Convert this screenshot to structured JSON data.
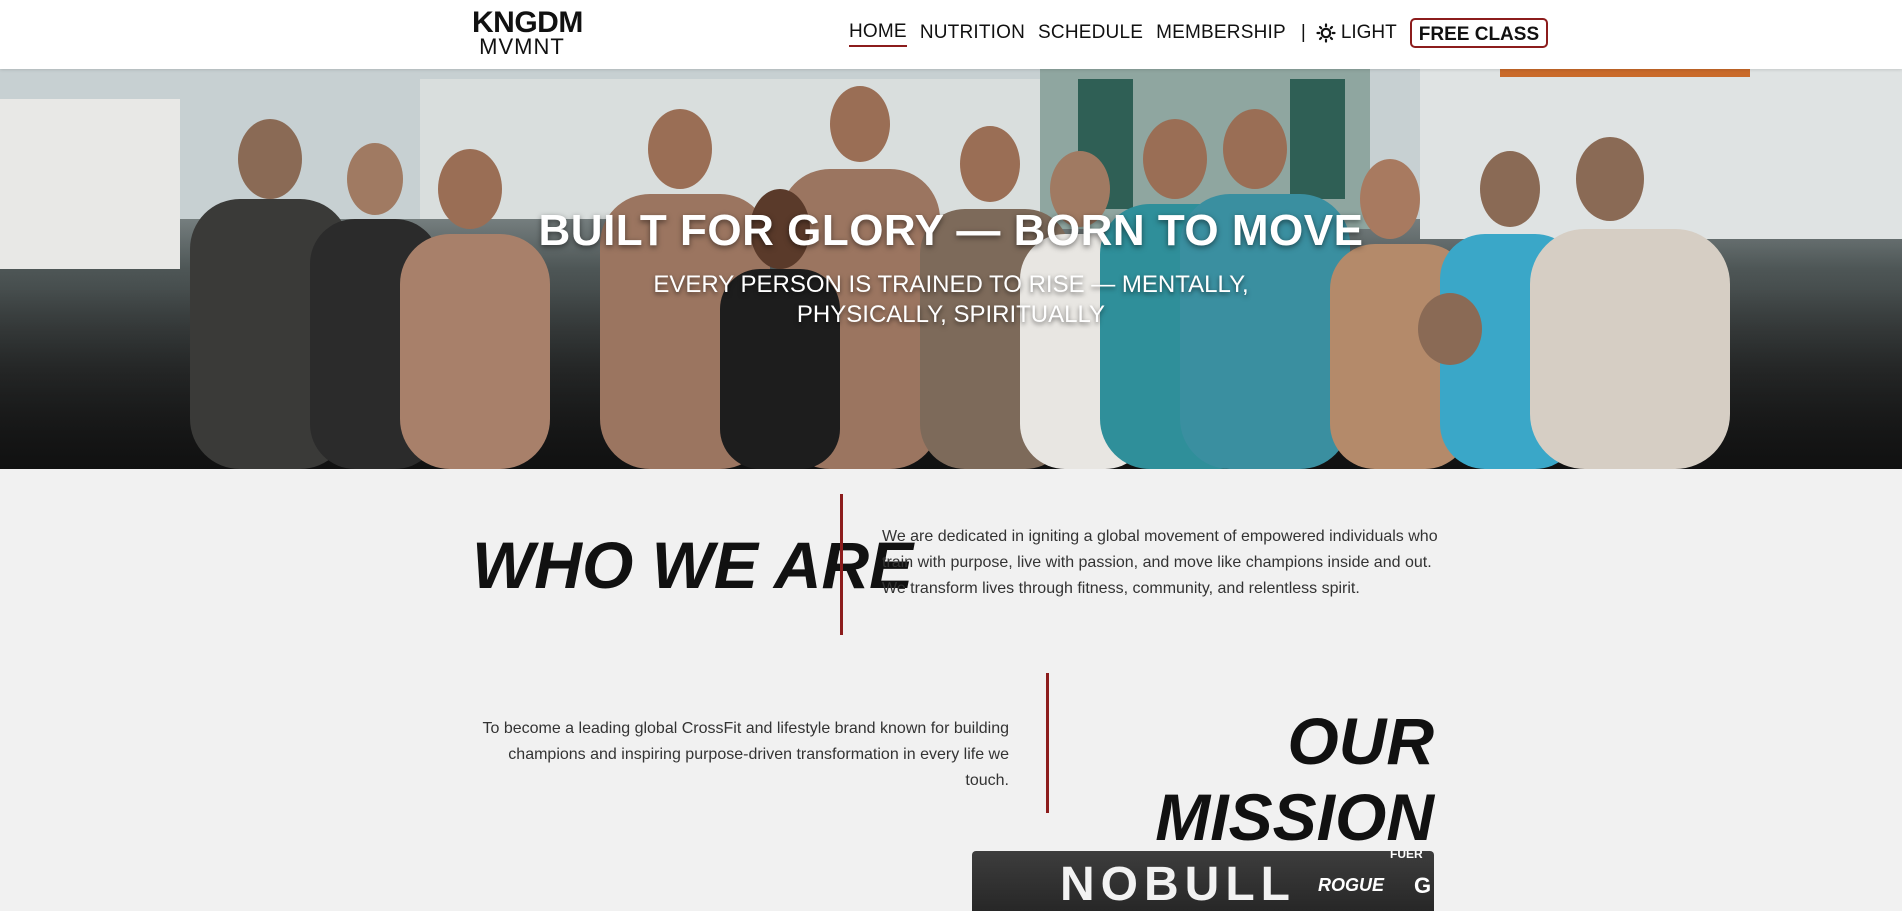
{
  "header": {
    "logo_top": "KNGDM",
    "logo_bottom": "MVMNT",
    "nav": {
      "home": "HOME",
      "nutrition": "NUTRITION",
      "schedule": "SCHEDULE",
      "membership": "MEMBERSHIP",
      "separator": "|",
      "theme_label": "LIGHT",
      "theme_icon": "sun-icon",
      "cta": "FREE CLASS"
    },
    "active": "HOME"
  },
  "hero": {
    "title": "BUILT FOR GLORY — BORN TO MOVE",
    "subtitle": "EVERY PERSON IS TRAINED TO RISE — MENTALLY, PHYSICALLY, SPIRITUALLY"
  },
  "who": {
    "title": "WHO WE ARE",
    "text": "We are dedicated in igniting a global movement of empowered individuals who train with purpose, live with passion, and move like champions inside and out. We transform lives through fitness, community, and relentless spirit."
  },
  "mission": {
    "title": "OUR MISSION",
    "text": "To become a leading global CrossFit and lifestyle brand known for building champions and inspiring purpose-driven transformation in every life we touch."
  },
  "card": {
    "nobull": "NOBULL",
    "rogue": "ROGUE",
    "gc": "G",
    "tag": "FUER"
  },
  "colors": {
    "accent": "#8c1c1c",
    "page_bg": "#f1f1f1",
    "header_bg": "#ffffff"
  }
}
